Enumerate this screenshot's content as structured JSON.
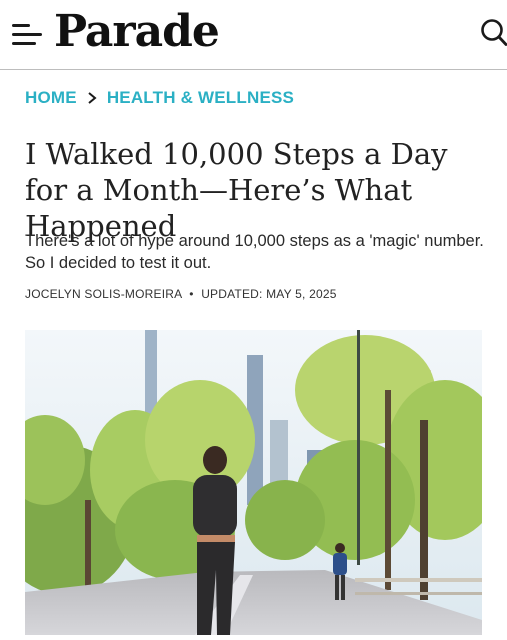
{
  "header": {
    "logo": "Parade",
    "menu_icon": "hamburger-menu-icon",
    "search_icon": "search-icon"
  },
  "breadcrumb": {
    "home": "HOME",
    "separator_icon": "chevron-right-icon",
    "section": "HEALTH & WELLNESS"
  },
  "article": {
    "title": "I Walked 10,000 Steps a Day for a Month—Here’s What Happened",
    "subtitle": "There's a lot of hype around 10,000 steps as a 'magic' number. So I decided to test it out.",
    "author": "JOCELYN SOLIS-MOREIRA",
    "byline_separator": "•",
    "updated": "UPDATED: MAY 5, 2025"
  },
  "colors": {
    "accent": "#2bb0c4",
    "text": "#1a1a1a",
    "divider": "#bdbdbd"
  }
}
